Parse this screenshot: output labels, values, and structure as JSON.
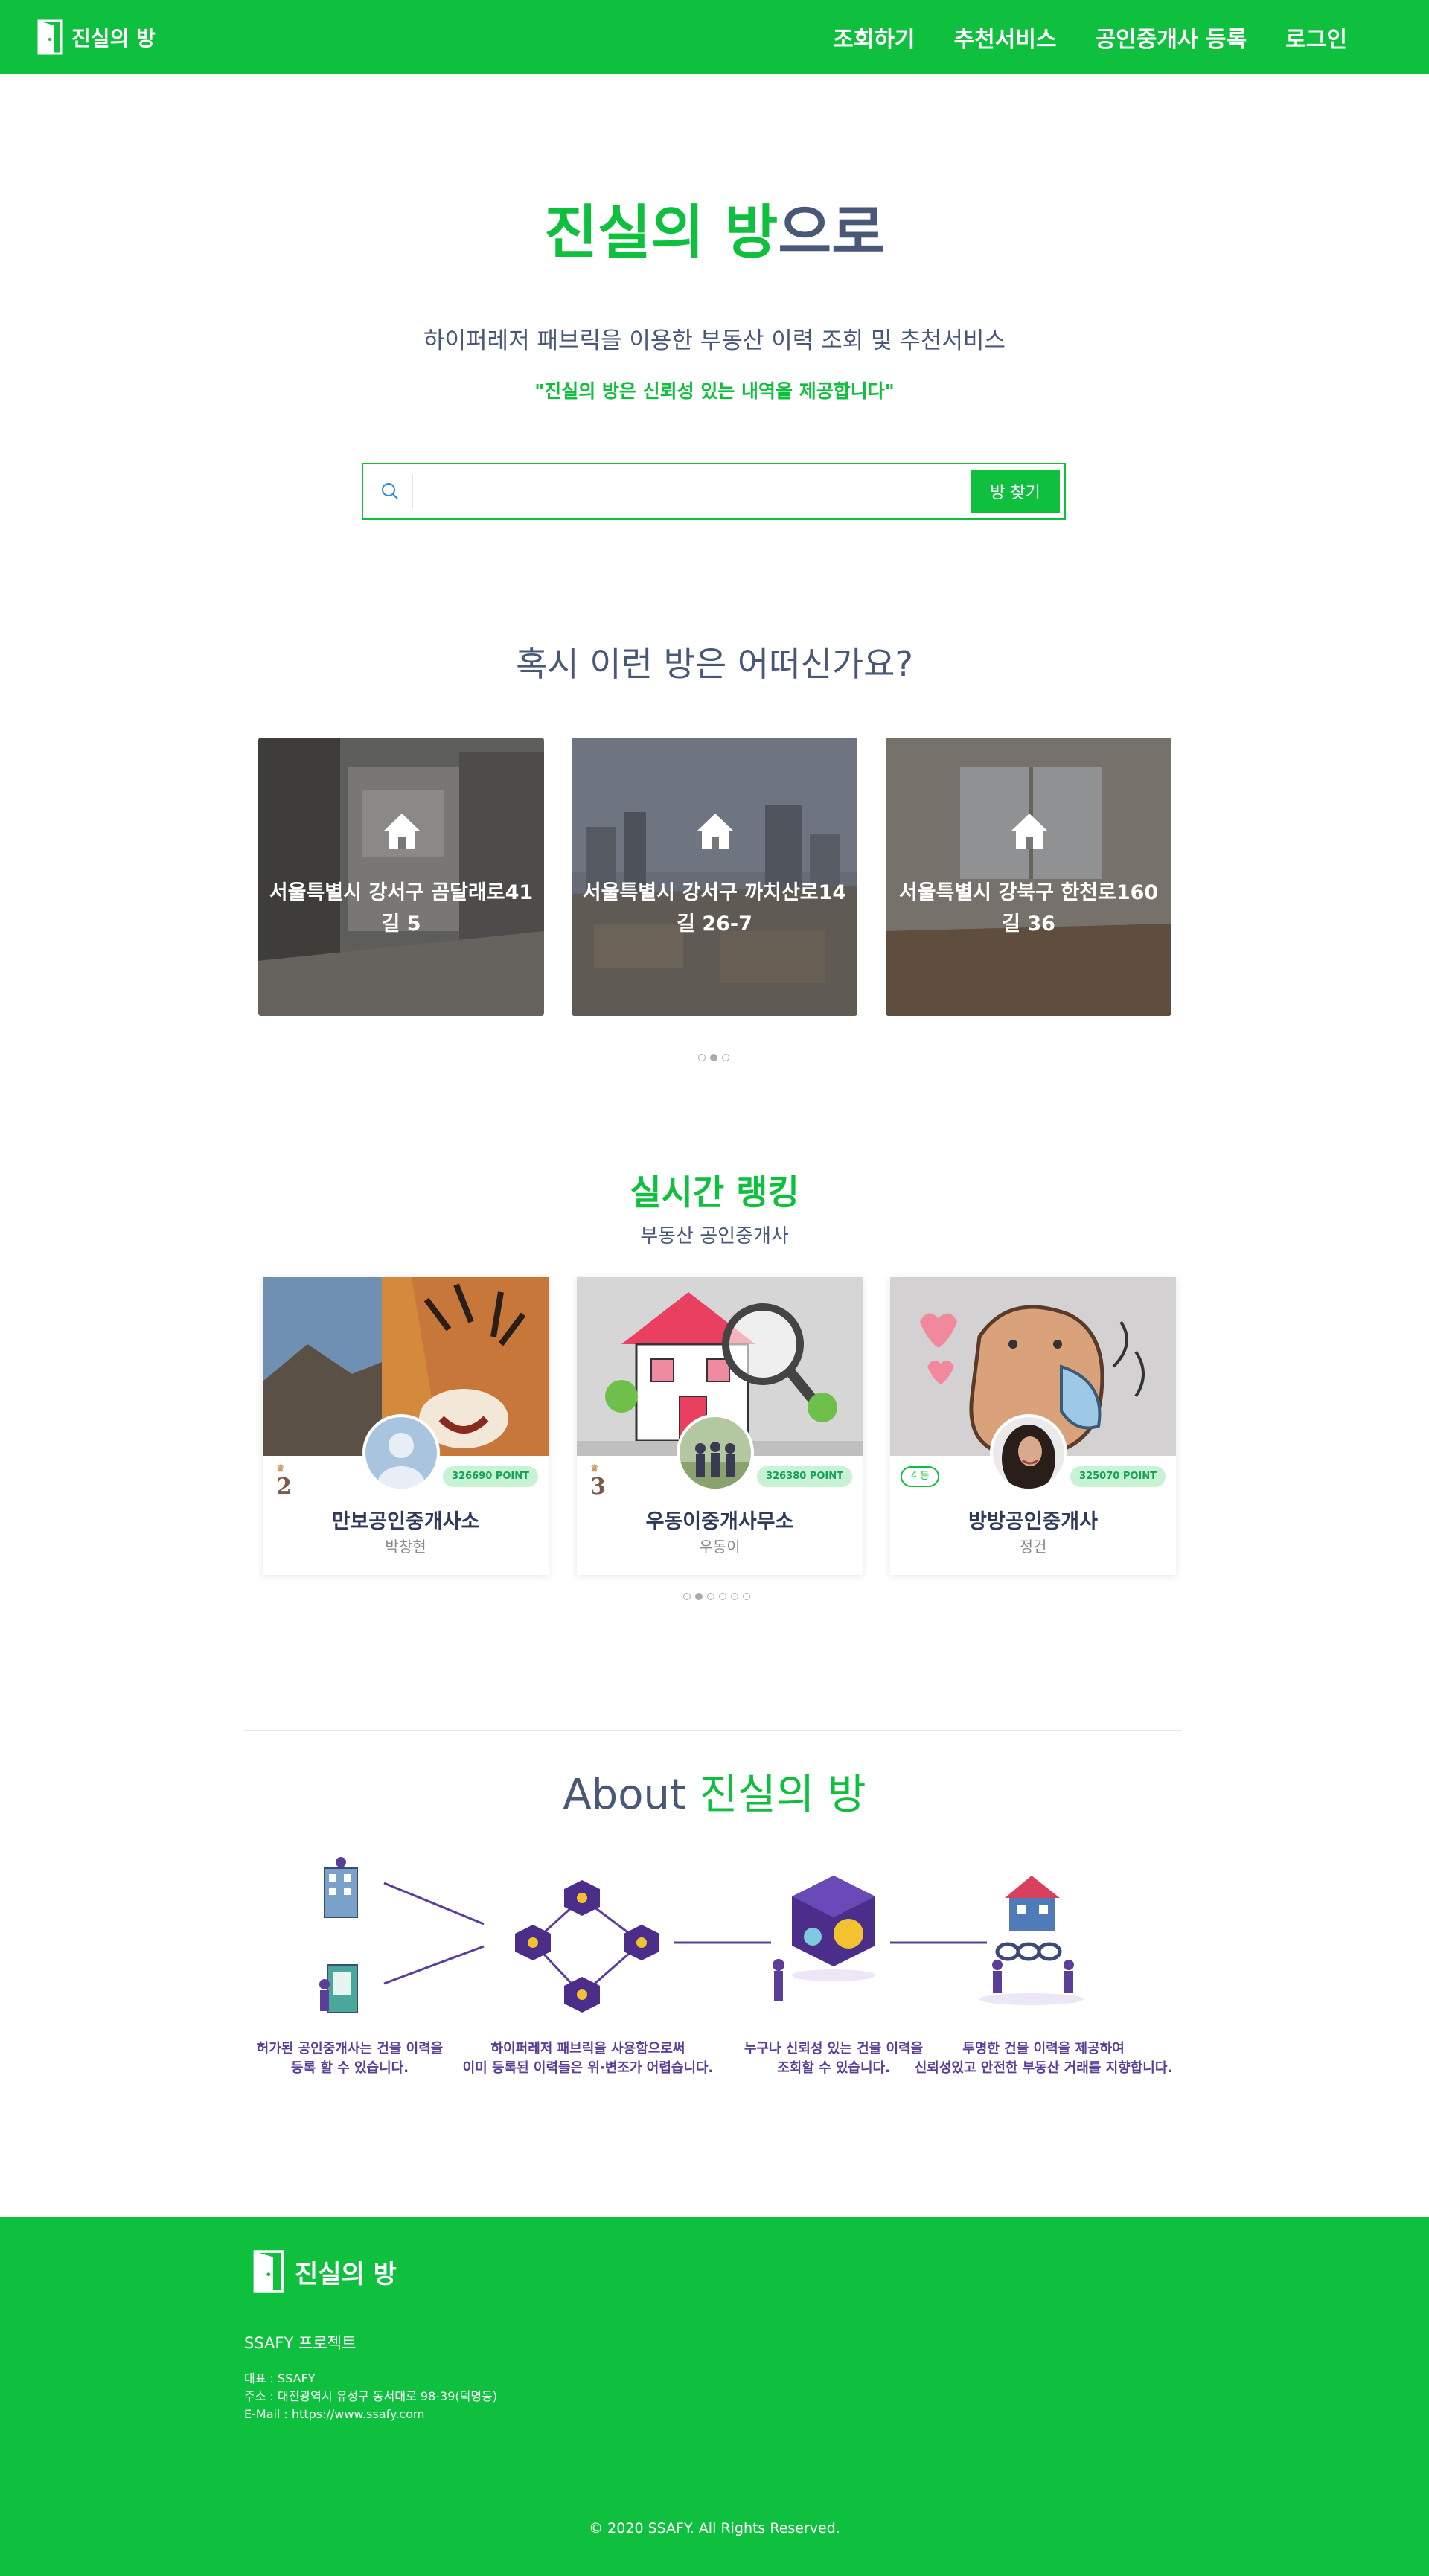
{
  "header": {
    "logo_text": "진실의 방",
    "nav": [
      "조회하기",
      "추천서비스",
      "공인중개사 등록",
      "로그인"
    ]
  },
  "hero": {
    "title_green": "진실의 방",
    "title_dark": "으로",
    "subtitle": "하이퍼레저 패브릭을 이용한 부동산 이력 조회 및 추천서비스",
    "quote": "\"진실의 방은 신뢰성 있는 내역을 제공합니다\""
  },
  "search": {
    "placeholder": "",
    "button_label": "방 찾기"
  },
  "recommend": {
    "title": "혹시 이런 방은 어떠신가요?",
    "rooms": [
      {
        "address": "서울특별시 강서구 곰달래로41길 5"
      },
      {
        "address": "서울특별시 강서구 까치산로14길 26-7"
      },
      {
        "address": "서울특별시 강북구 한천로160길 36"
      }
    ],
    "dots": 3,
    "active_dot": 1
  },
  "ranking": {
    "title": "실시간 랭킹",
    "subtitle": "부동산 공인중개사",
    "cards": [
      {
        "rank": "2",
        "name": "만보공인중개사소",
        "owner": "박창현",
        "points": "326690 POINT"
      },
      {
        "rank": "3",
        "name": "우동이중개사무소",
        "owner": "우동이",
        "points": "326380 POINT"
      },
      {
        "rank": "4 등",
        "name": "방방공인중개사",
        "owner": "정건",
        "points": "325070 POINT"
      }
    ],
    "dots": 6,
    "active_dot": 1
  },
  "about": {
    "title_dark": "About ",
    "title_green": "진실의 방",
    "steps": [
      {
        "line1": "허가된 공인중개사는 건물 이력을",
        "line2": "등록 할 수 있습니다."
      },
      {
        "line1": "하이퍼레저 패브릭을 사용함으로써",
        "line2": "이미 등록된 이력들은 위·변조가 어렵습니다."
      },
      {
        "line1": "누구나 신뢰성 있는 건물 이력을",
        "line2": "조회할 수 있습니다."
      },
      {
        "line1": "투명한 건물 이력을 제공하여",
        "line2": "신뢰성있고 안전한 부동산 거래를 지향합니다."
      }
    ]
  },
  "footer": {
    "logo_text": "진실의 방",
    "project": "SSAFY 프로젝트",
    "ceo": "대표 : SSAFY",
    "address": "주소 : 대전광역시 유성구 동서대로 98-39(덕명동)",
    "email": "E-Mail : https://www.ssafy.com",
    "copyright": "© 2020 SSAFY. All Rights Reserved."
  },
  "colors": {
    "brand_green": "#0fbf3e",
    "text_navy": "#4a5878",
    "illustration_purple": "#5b3e98"
  }
}
